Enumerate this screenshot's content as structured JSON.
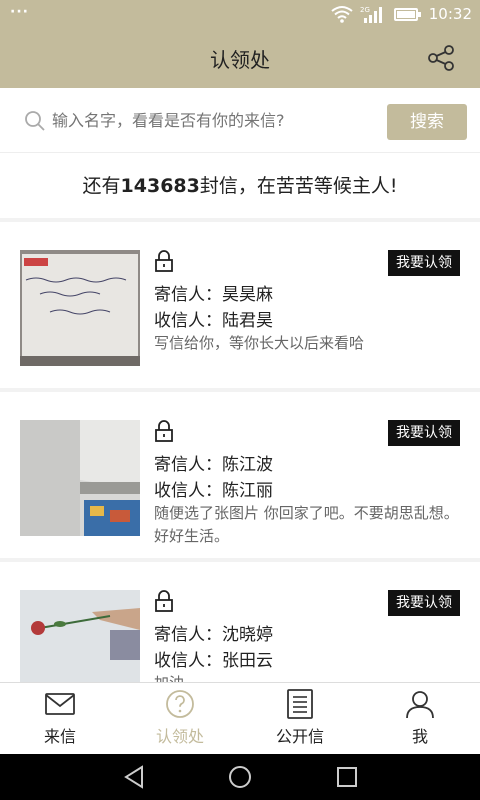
{
  "status_bar": {
    "time": "10:32",
    "dots": "···",
    "network": "2G"
  },
  "header": {
    "title": "认领处"
  },
  "search": {
    "placeholder": "输入名字，看看是否有你的来信?",
    "button_label": "搜索"
  },
  "summary": {
    "prefix": "还有",
    "count": "143683",
    "suffix": "封信，在苦苦等候主人!"
  },
  "letters": [
    {
      "claim_label": "我要认领",
      "sender_label": "寄信人：",
      "sender": "昊昊麻",
      "recipient_label": "收信人：",
      "recipient": "陆君昊",
      "message": "写信给你，等你长大以后来看哈"
    },
    {
      "claim_label": "我要认领",
      "sender_label": "寄信人：",
      "sender": "陈江波",
      "recipient_label": "收信人：",
      "recipient": "陈江丽",
      "message": "随便选了张图片 你回家了吧。不要胡思乱想。好好生活。"
    },
    {
      "claim_label": "我要认领",
      "sender_label": "寄信人：",
      "sender": "沈晓婷",
      "recipient_label": "收信人：",
      "recipient": "张田云",
      "message": "加油"
    }
  ],
  "nav": {
    "items": [
      {
        "label": "来信",
        "icon": "envelope-icon"
      },
      {
        "label": "认领处",
        "icon": "question-icon",
        "active": true
      },
      {
        "label": "公开信",
        "icon": "document-icon"
      },
      {
        "label": "我",
        "icon": "user-icon"
      }
    ]
  },
  "colors": {
    "accent": "#c3bb9c",
    "badge": "#111111"
  }
}
